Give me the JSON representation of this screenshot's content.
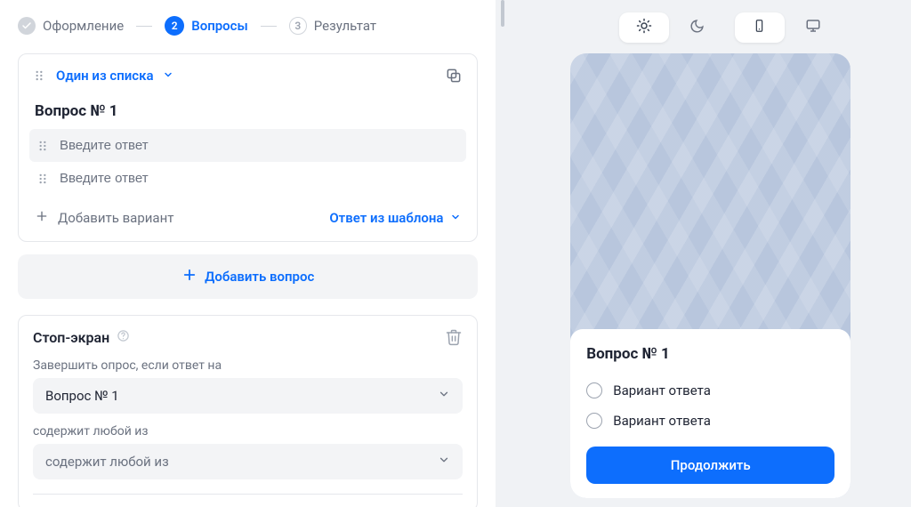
{
  "steps": [
    {
      "label": "Оформление",
      "state": "done"
    },
    {
      "label": "Вопросы",
      "state": "active",
      "num": "2"
    },
    {
      "label": "Результат",
      "state": "future",
      "num": "3"
    }
  ],
  "question_card": {
    "type_label": "Один из списка",
    "title": "Вопрос № 1",
    "answer_placeholder_1": "Введите ответ",
    "answer_placeholder_2": "Введите ответ",
    "add_variant_label": "Добавить вариант",
    "template_answer_label": "Ответ из шаблона"
  },
  "add_question_label": "Добавить вопрос",
  "stop_screen": {
    "title": "Стоп-экран",
    "label_if": "Завершить опрос, если ответ на",
    "select_question": "Вопрос № 1",
    "label_contains": "содержит любой из",
    "select_match_placeholder": "содержит любой из"
  },
  "preview": {
    "question_title": "Вопрос № 1",
    "option1": "Вариант ответа",
    "option2": "Вариант ответа",
    "continue_label": "Продолжить"
  }
}
